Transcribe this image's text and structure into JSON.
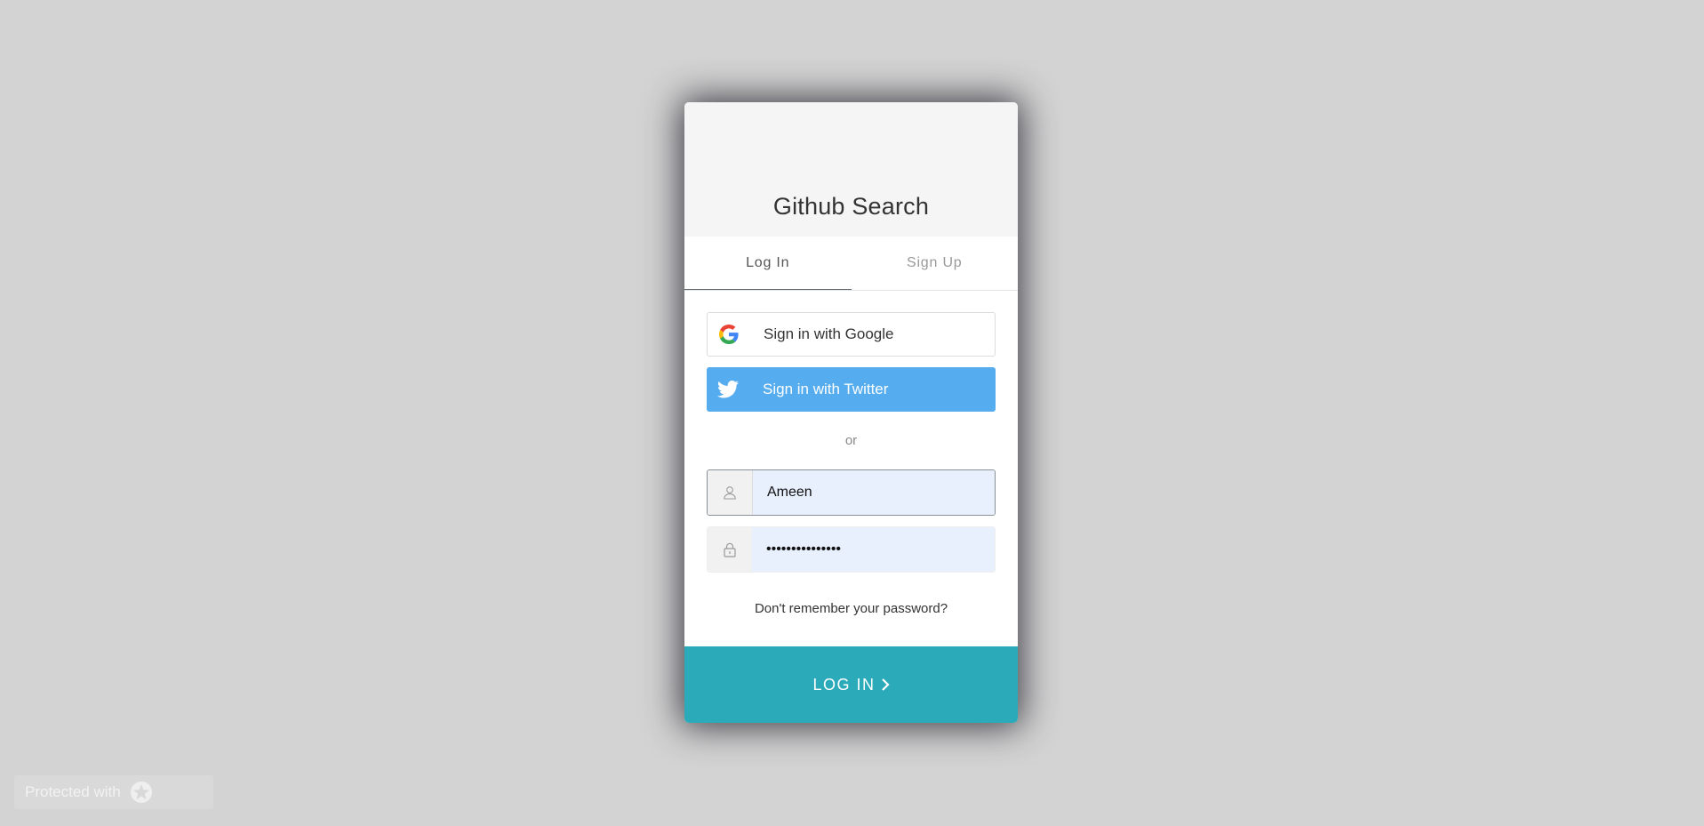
{
  "app": {
    "title": "Github Search"
  },
  "tabs": [
    {
      "label": "Log In",
      "active": true
    },
    {
      "label": "Sign Up",
      "active": false
    }
  ],
  "social": {
    "google_label": "Sign in with Google",
    "twitter_label": "Sign in with Twitter",
    "google_icon": "google-g-icon",
    "twitter_icon": "twitter-bird-icon",
    "twitter_color": "#55acee"
  },
  "divider": {
    "text": "or"
  },
  "form": {
    "username_value": "Ameen",
    "username_icon": "user-icon",
    "password_value": "password-masked",
    "password_icon": "lock-icon",
    "forgot_text": "Don't remember your password?"
  },
  "submit": {
    "label": "LOG IN",
    "color": "#2babba"
  },
  "badge": {
    "text": "Protected with"
  }
}
